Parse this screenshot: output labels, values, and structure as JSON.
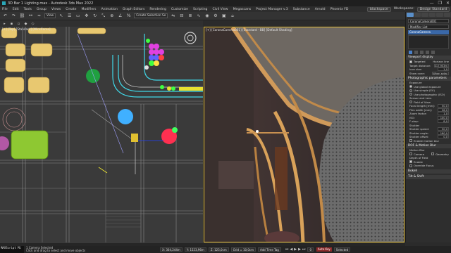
{
  "window": {
    "title": "3D Bar 1 Lighting.max - Autodesk 3ds Max 2022",
    "controls": [
      "—",
      "❐",
      "✕"
    ]
  },
  "menu": {
    "items": [
      "File",
      "Edit",
      "Tools",
      "Group",
      "Views",
      "Create",
      "Modifiers",
      "Animation",
      "Graph Editors",
      "Rendering",
      "Customize",
      "Scripting",
      "Civil View",
      "Megascans",
      "Project Manager v.3",
      "Substance",
      "Arnold",
      "Phoenix FD"
    ],
    "user": "blackspace",
    "workspace_label": "Workspaces:",
    "workspace_value": "Design Standard"
  },
  "toolbar": {
    "selection_set": "Create Selection Se",
    "view_dropdown": "View",
    "icons": [
      "undo-icon",
      "redo-icon",
      "link-icon",
      "unlink-icon",
      "bind-icon",
      "select-icon",
      "select-name-icon",
      "rect-select-icon",
      "move-icon",
      "rotate-icon",
      "scale-icon",
      "snap-icon",
      "angle-snap-icon",
      "percent-snap-icon",
      "mirror-icon",
      "align-icon",
      "layer-icon",
      "curve-editor-icon",
      "material-editor-icon",
      "render-setup-icon",
      "render-frame-icon",
      "render-icon"
    ]
  },
  "left_viewport": {
    "label": "[+] [Top] [Standard] [Wireframe]"
  },
  "right_viewport": {
    "label": "[+] [CoronaCamera001] [Standard - BB] [Default Shading]"
  },
  "command_panel": {
    "object_name": "CoronaCamera001",
    "modifier_list": "Modifier List",
    "selected_modifier": "CoronaCamera",
    "sections": [
      {
        "title": "Viewport display",
        "rows": [
          {
            "label": "Targeted",
            "check": true,
            "extra": "Horizon line"
          },
          {
            "label": "Target distance:",
            "value": "317,953m"
          },
          {
            "label": "Icon size:",
            "value": "1,0"
          },
          {
            "label": "Show cone:",
            "value": "When selec"
          }
        ]
      },
      {
        "title": "Photographic parameters",
        "rows": [
          {
            "label": "Exposure",
            "heading": true
          },
          {
            "label": "Use global exposure",
            "radio": true
          },
          {
            "label": "Use simple (EV)",
            "radio": false
          },
          {
            "label": "Use photographic (ISO)",
            "radio": false
          },
          {
            "label": "Sensor and Lens",
            "heading": true
          },
          {
            "label": "Field of View",
            "radio": false
          },
          {
            "label": "Focal length [mm]:",
            "value": "50,0"
          },
          {
            "label": "Film width [mm]:",
            "value": "36,0"
          },
          {
            "label": "Zoom factor:",
            "value": "1,0"
          },
          {
            "label": "ISO:",
            "value": "100,0"
          },
          {
            "label": "F-stop:",
            "value": "8,0"
          },
          {
            "label": "Shutter",
            "heading": true
          },
          {
            "label": "Shutter speed:",
            "value": "50,0"
          },
          {
            "label": "Shutter angle:",
            "value": "180,0"
          },
          {
            "label": "Shutter offset:",
            "value": "0,0"
          },
          {
            "label": "Enable motion blur",
            "check": false
          }
        ]
      },
      {
        "title": "DOF & Motion Blur",
        "rows": [
          {
            "label": "Motion Blur",
            "heading": true
          },
          {
            "label": "Camera",
            "check": false,
            "extra": "Geometry"
          },
          {
            "label": "Depth of Field",
            "heading": true
          },
          {
            "label": "Enable",
            "check": true
          },
          {
            "label": "Override Focus",
            "check": false
          }
        ]
      }
    ],
    "collapsed": [
      "Bokeh",
      "Tilt & Shift"
    ]
  },
  "status": {
    "maxscript_label": "MAXScript Mi",
    "line1": "1 Camera Selected",
    "line2": "Click and drag to select and move objects",
    "x": "X: 304,244m",
    "y": "Y: 1523,96m",
    "z": "Z: 125,0cm",
    "grid": "Grid = 10,0cm",
    "add_time_tag": "Add Time Tag",
    "autokey": "Auto Key",
    "selected": "Selected",
    "frame": "0"
  }
}
